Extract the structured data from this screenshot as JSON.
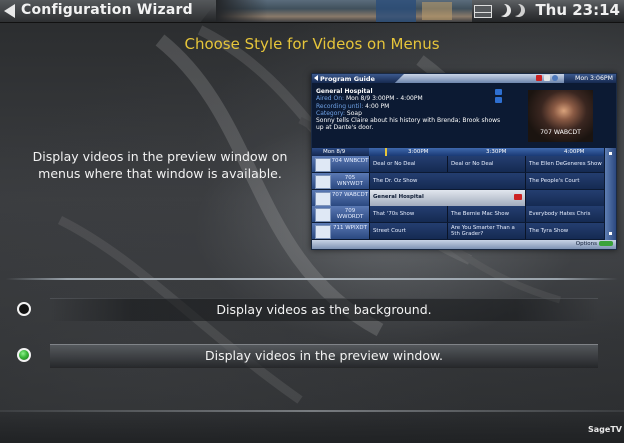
{
  "window": {
    "title": "Configuration Wizard",
    "clock": "Thu 23:14",
    "logo": "SageTV"
  },
  "page": {
    "heading": "Choose Style for Videos on Menus",
    "description": "Display videos in the preview window on menus where that window is available."
  },
  "preview": {
    "title": "Program Guide",
    "clock": "Mon 3:06PM",
    "show_title": "General Hospital",
    "aired_label": "Aired On:",
    "aired_value": "Mon 8/9 3:00PM - 4:00PM",
    "recording_label": "Recording until:",
    "recording_value": "4:00 PM",
    "category_label": "Category:",
    "category_value": "Soap",
    "synopsis": "Sonny tells Claire about his history with Brenda; Brook shows up at Dante's door.",
    "thumb_label": "707 WABCDT",
    "date": "Mon 8/9",
    "times": [
      "3:00PM",
      "3:30PM",
      "4:00PM"
    ],
    "rows": [
      {
        "channel": "704 WNBCDT",
        "programs": [
          "Deal or No Deal",
          "Deal or No Deal",
          "The Ellen DeGeneres Show"
        ]
      },
      {
        "channel": "705 WNYWDT",
        "programs": [
          "The Dr. Oz Show",
          "",
          "The People's Court"
        ]
      },
      {
        "channel": "707 WABCDT",
        "programs": [
          "General Hospital",
          "",
          ""
        ]
      },
      {
        "channel": "709 WWORDT",
        "programs": [
          "That '70s Show",
          "The Bernie Mac Show",
          "Everybody Hates Chris"
        ]
      },
      {
        "channel": "711 WPIXDT",
        "programs": [
          "Street Court",
          "Are You Smarter Than a 5th Grader?",
          "The Tyra Show"
        ]
      }
    ],
    "options": "Options"
  },
  "options": [
    {
      "label": "Display videos as the background.",
      "selected": false
    },
    {
      "label": "Display videos in the preview window.",
      "selected": true
    }
  ],
  "colors": {
    "heading": "#e6c53a",
    "radio_selected": "#39b739"
  }
}
